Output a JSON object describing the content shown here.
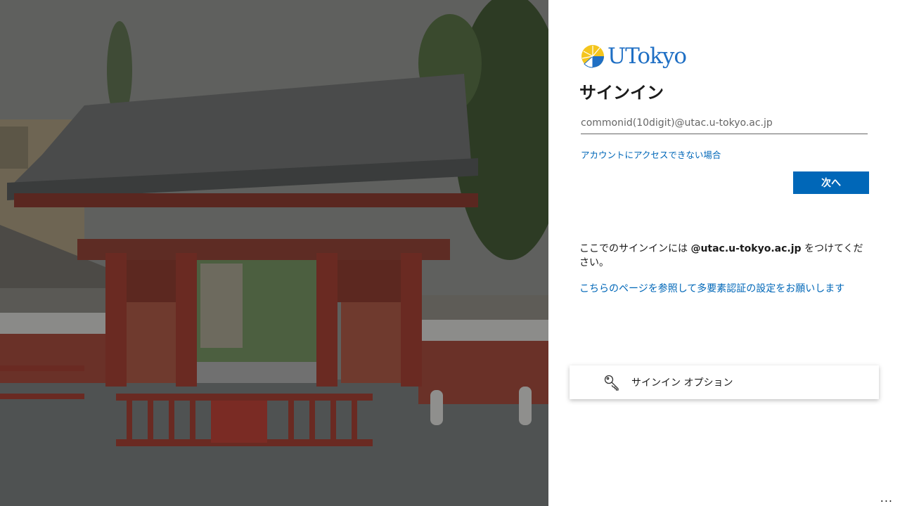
{
  "brand": {
    "logo_text": "UTokyo",
    "accent_color": "#0067b8",
    "logo_color": "#1f6fc4"
  },
  "signin": {
    "title": "サインイン",
    "email_placeholder": "commonid(10digit)@utac.u-tokyo.ac.jp",
    "email_value": "",
    "cant_access_link": "アカウントにアクセスできない場合",
    "next_button": "次へ"
  },
  "notice": {
    "before": "ここでのサインインには ",
    "domain": "@utac.u-tokyo.ac.jp",
    "after": " をつけてください。",
    "mfa_link": "こちらのページを参照して多要素認証の設定をお願いします"
  },
  "options": {
    "label": "サインイン オプション",
    "icon": "key-icon"
  },
  "footer": {
    "more_label": "..."
  },
  "background": {
    "image": "akamon-gate-photo"
  }
}
